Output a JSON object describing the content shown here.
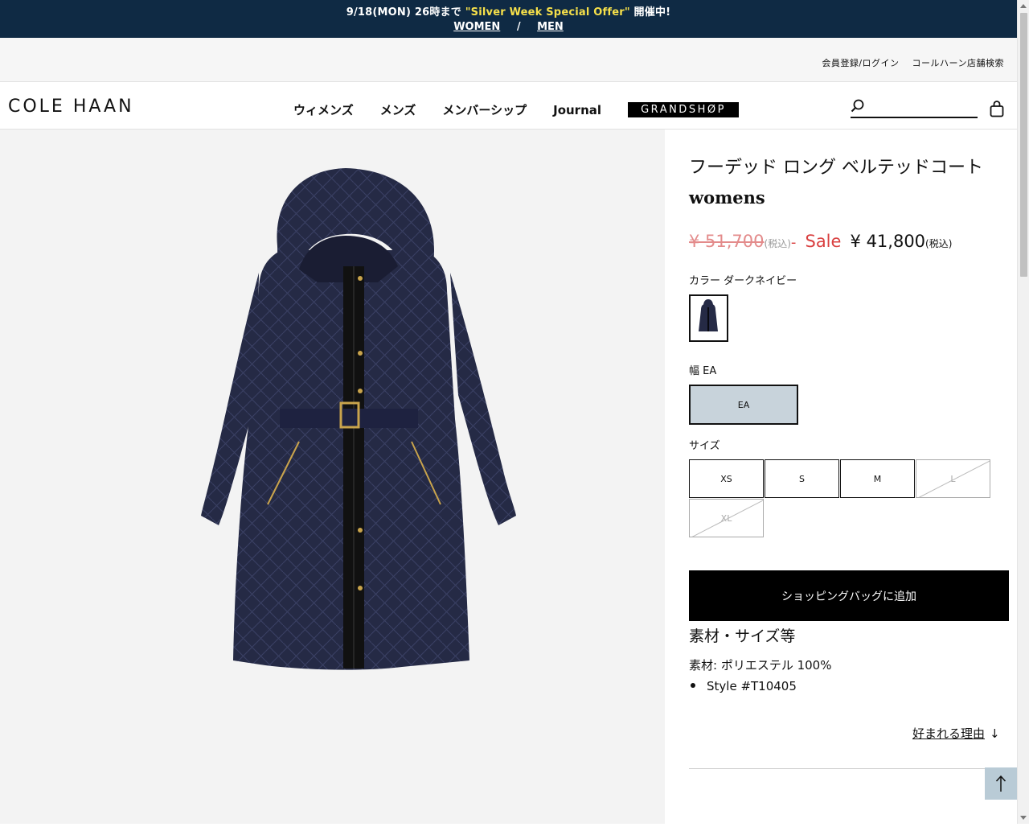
{
  "promo": {
    "prefix": "9/18(MON) 26時まで ",
    "highlight": "\"Silver Week Special Offer\"",
    "suffix": " 開催中!",
    "women": "WOMEN",
    "separator": "/",
    "men": "MEN"
  },
  "utility": {
    "login": "会員登録/ログイン",
    "store_search": "コールハーン店舗検索"
  },
  "header": {
    "logo": "COLE HAAN",
    "nav": [
      "ウィメンズ",
      "メンズ",
      "メンバーシップ",
      "Journal"
    ],
    "grandshop": "GRANDSHØP",
    "search_placeholder": ""
  },
  "product": {
    "title": "フーデッド ロング ベルテッドコート",
    "subtitle": "womens",
    "price_old": "¥ 51,700",
    "tax_label": "(税込)",
    "price_dash": "-",
    "sale_label": "Sale",
    "price_now": "¥ 41,800",
    "color_label": "カラー ダークネイビー",
    "width_label": "幅 EA",
    "width_option": "EA",
    "size_label": "サイズ",
    "sizes": [
      {
        "label": "XS",
        "available": true
      },
      {
        "label": "S",
        "available": true
      },
      {
        "label": "M",
        "available": true
      },
      {
        "label": "L",
        "available": false
      },
      {
        "label": "XL",
        "available": false
      }
    ],
    "add_to_bag": "ショッピングバッグに追加",
    "materials_heading": "素材・サイズ等",
    "material": "素材: ポリエステル 100%",
    "style": "Style #T10405",
    "why_loved": "好まれる理由"
  },
  "colors": {
    "promo_bg": "#0f2a44",
    "promo_highlight": "#f6e04a",
    "sale_red": "#d94040",
    "coat_navy": "#252a45",
    "width_selected": "#c8d3db",
    "totop_bg": "#b9cbd6"
  }
}
